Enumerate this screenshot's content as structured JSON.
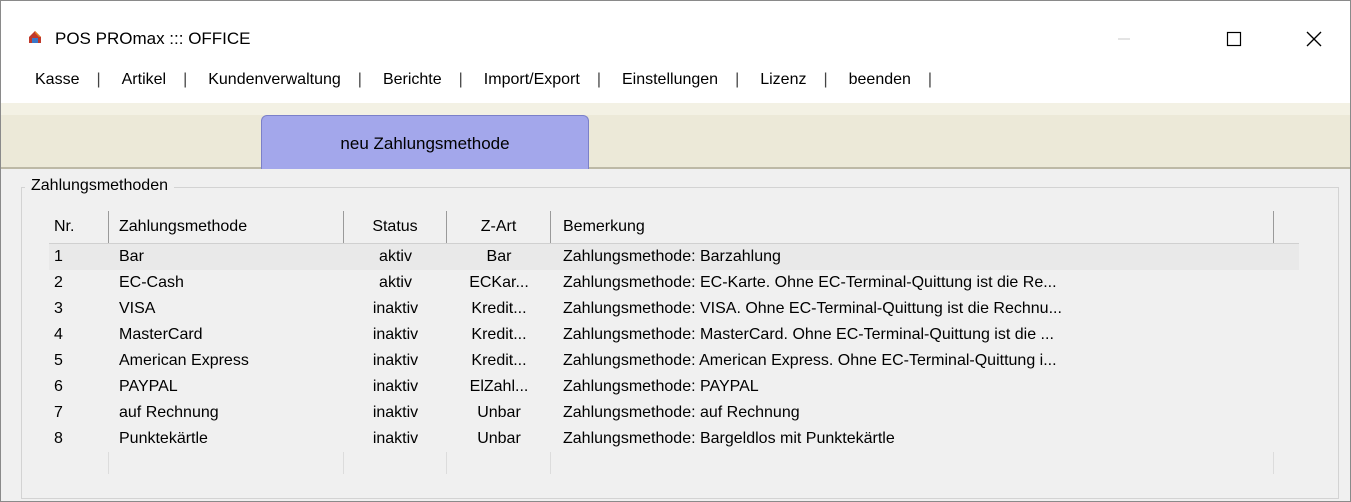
{
  "window": {
    "title": "POS PROmax ::: OFFICE"
  },
  "menu": [
    {
      "label": "Kasse"
    },
    {
      "label": "Artikel"
    },
    {
      "label": "Kundenverwaltung"
    },
    {
      "label": "Berichte"
    },
    {
      "label": "Import/Export"
    },
    {
      "label": "Einstellungen"
    },
    {
      "label": "Lizenz"
    },
    {
      "label": "beenden"
    }
  ],
  "menu_separator": "|",
  "tab": {
    "label": "neu Zahlungsmethode",
    "color": "#a3a7eb"
  },
  "group": {
    "legend": "Zahlungsmethoden"
  },
  "table": {
    "columns": [
      "Nr.",
      "Zahlungsmethode",
      "Status",
      "Z-Art",
      "Bemerkung"
    ],
    "rows": [
      {
        "nr": "1",
        "method": "Bar",
        "status": "aktiv",
        "zart": "Bar",
        "note": "Zahlungsmethode: Barzahlung"
      },
      {
        "nr": "2",
        "method": "EC-Cash",
        "status": "aktiv",
        "zart": "ECKar...",
        "note": "Zahlungsmethode: EC-Karte. Ohne EC-Terminal-Quittung ist die Re..."
      },
      {
        "nr": "3",
        "method": "VISA",
        "status": "inaktiv",
        "zart": "Kredit...",
        "note": "Zahlungsmethode: VISA. Ohne EC-Terminal-Quittung ist die Rechnu..."
      },
      {
        "nr": "4",
        "method": "MasterCard",
        "status": "inaktiv",
        "zart": "Kredit...",
        "note": "Zahlungsmethode: MasterCard. Ohne EC-Terminal-Quittung ist die ..."
      },
      {
        "nr": "5",
        "method": "American Express",
        "status": "inaktiv",
        "zart": "Kredit...",
        "note": "Zahlungsmethode: American Express. Ohne EC-Terminal-Quittung i..."
      },
      {
        "nr": "6",
        "method": "PAYPAL",
        "status": "inaktiv",
        "zart": "ElZahl...",
        "note": "Zahlungsmethode: PAYPAL"
      },
      {
        "nr": "7",
        "method": "auf Rechnung",
        "status": "inaktiv",
        "zart": "Unbar",
        "note": "Zahlungsmethode: auf Rechnung"
      },
      {
        "nr": "8",
        "method": "Punktekärtle",
        "status": "inaktiv",
        "zart": "Unbar",
        "note": "Zahlungsmethode: Bargeldlos mit Punktekärtle"
      }
    ]
  },
  "icons": {
    "app": "pos-app-icon",
    "minimize": "minimize-icon",
    "maximize": "maximize-icon",
    "close": "close-icon"
  }
}
